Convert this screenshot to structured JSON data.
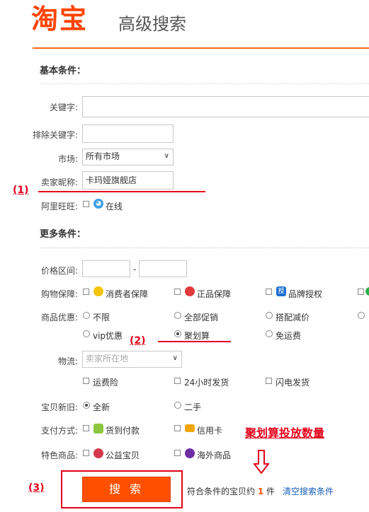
{
  "header": {
    "logo": "淘宝",
    "title": "高级搜索"
  },
  "basic": {
    "title": "基本条件：",
    "keyword_label": "关键字:",
    "exclude_label": "排除关键字:",
    "market_label": "市场:",
    "market_value": "所有市场",
    "seller_label": "卖家昵称:",
    "seller_value": "卡玛娅旗舰店",
    "wangwang_label": "阿里旺旺:",
    "online_label": "在线"
  },
  "more": {
    "title": "更多条件：",
    "price_label": "价格区间:",
    "price_dash": "-",
    "guarantee_label": "购物保障:",
    "guarantees": [
      "消费者保障",
      "正品保障",
      "品牌授权"
    ],
    "discount_label": "商品优惠:",
    "discounts_row1": [
      "不限",
      "全部促销",
      "搭配减价"
    ],
    "discounts_row2": [
      "vip优惠",
      "聚划算",
      "免运费"
    ],
    "discount_selected": "聚划算",
    "logistics_label": "物流:",
    "logistics_placeholder": "卖家所在地",
    "logistics_options": [
      "运费险",
      "24小时发货",
      "闪电发货"
    ],
    "new_label": "宝贝新旧:",
    "new_options": [
      "全新",
      "二手"
    ],
    "new_selected": "全新",
    "payment_label": "支付方式:",
    "payment_options": [
      "货到付款",
      "信用卡"
    ],
    "special_label": "特色商品:",
    "special_options": [
      "公益宝贝",
      "海外商品"
    ]
  },
  "footer": {
    "search_button": "搜 索",
    "result_prefix": "符合条件的宝贝约",
    "result_count": "1",
    "result_suffix": "件",
    "clear_link": "清空搜索条件"
  },
  "annotations": {
    "mark1": "(1)",
    "mark2": "(2)",
    "mark3": "(3)",
    "note": "聚划算投放数量"
  },
  "colors": {
    "brand": "#ff5000",
    "annotation": "#e4001a",
    "link": "#1a5fb4"
  }
}
